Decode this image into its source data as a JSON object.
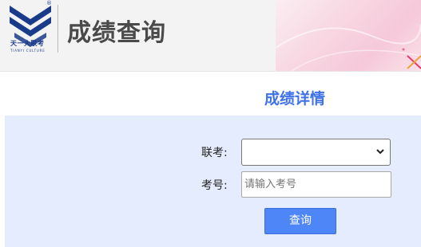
{
  "header": {
    "logo_cn": "天一大联考",
    "logo_en": "TIANYI CULTURE",
    "registered_mark": "®",
    "title": "成绩查询"
  },
  "main": {
    "section_title": "成绩详情",
    "form": {
      "exam_label": "联考:",
      "exam_select_value": "",
      "exam_no_label": "考号:",
      "exam_no_placeholder": "请输入考号",
      "exam_no_value": "",
      "query_button_label": "查询"
    }
  },
  "icons": {
    "logo": "tianyi-logo-icon",
    "select_arrow": "chevron-down-icon"
  },
  "colors": {
    "brand_blue": "#1a3b8a",
    "accent_blue": "#3f72e8",
    "button_blue": "#4f86f7",
    "panel_bg": "#e5ecfd"
  }
}
